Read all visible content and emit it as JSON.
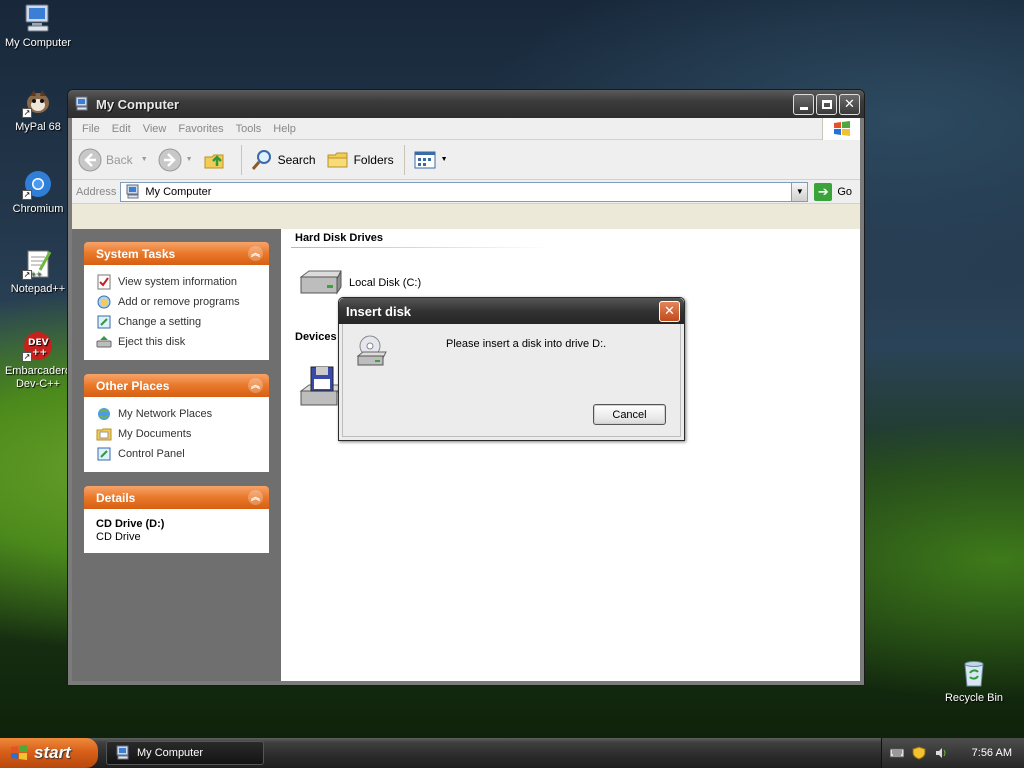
{
  "desktop": {
    "icons": [
      {
        "label": "My Computer"
      },
      {
        "label": "MyPal 68"
      },
      {
        "label": "Chromium"
      },
      {
        "label": "Notepad++"
      },
      {
        "label": "Embarcadero Dev-C++"
      },
      {
        "label": "Recycle Bin"
      }
    ]
  },
  "window": {
    "title": "My Computer",
    "menu": [
      "File",
      "Edit",
      "View",
      "Favorites",
      "Tools",
      "Help"
    ],
    "toolbar": {
      "back": "Back",
      "search": "Search",
      "folders": "Folders"
    },
    "address": {
      "label": "Address",
      "value": "My Computer",
      "go": "Go"
    },
    "left_pane": {
      "system_tasks": {
        "title": "System Tasks",
        "items": [
          "View system information",
          "Add or remove programs",
          "Change a setting",
          "Eject this disk"
        ]
      },
      "other_places": {
        "title": "Other Places",
        "items": [
          "My Network Places",
          "My Documents",
          "Control Panel"
        ]
      },
      "details": {
        "title": "Details",
        "name": "CD Drive (D:)",
        "type": "CD Drive"
      }
    },
    "groups": [
      {
        "title": "Hard Disk Drives",
        "items": [
          "Local Disk (C:)"
        ]
      },
      {
        "title": "Devices"
      }
    ]
  },
  "dialog": {
    "title": "Insert disk",
    "message": "Please insert a disk into drive D:.",
    "cancel": "Cancel"
  },
  "taskbar": {
    "start": "start",
    "task": "My Computer",
    "clock": "7:56 AM"
  },
  "colors": {
    "accent_orange": "#e9782a",
    "title_gray": "#3b3b3b",
    "pane_gray": "#6f6f6f"
  }
}
